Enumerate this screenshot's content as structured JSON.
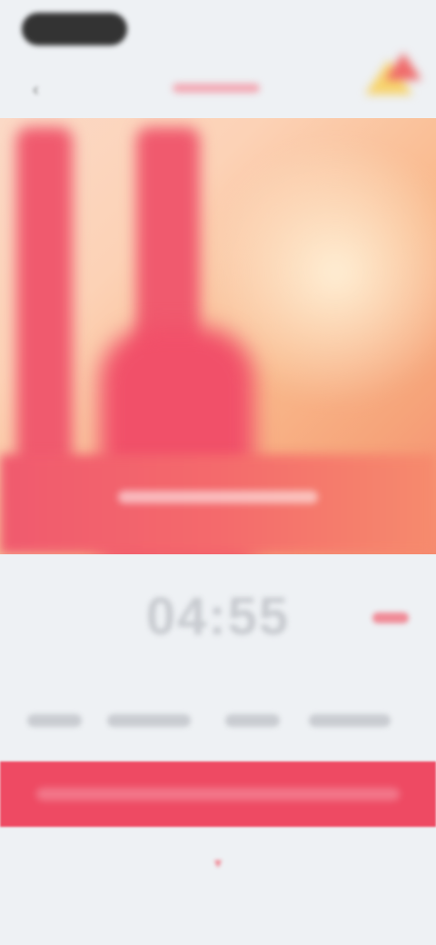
{
  "header": {
    "back_icon": "back-arrow-icon",
    "corner_icon": "decorative-triangles-icon"
  },
  "time": {
    "display": "04:55"
  },
  "colors": {
    "accent": "#ee4a63",
    "background": "#eef1f4",
    "hero_warm": "#f9b88b"
  },
  "footer": {
    "indicator_icon": "chevron-down-icon"
  }
}
